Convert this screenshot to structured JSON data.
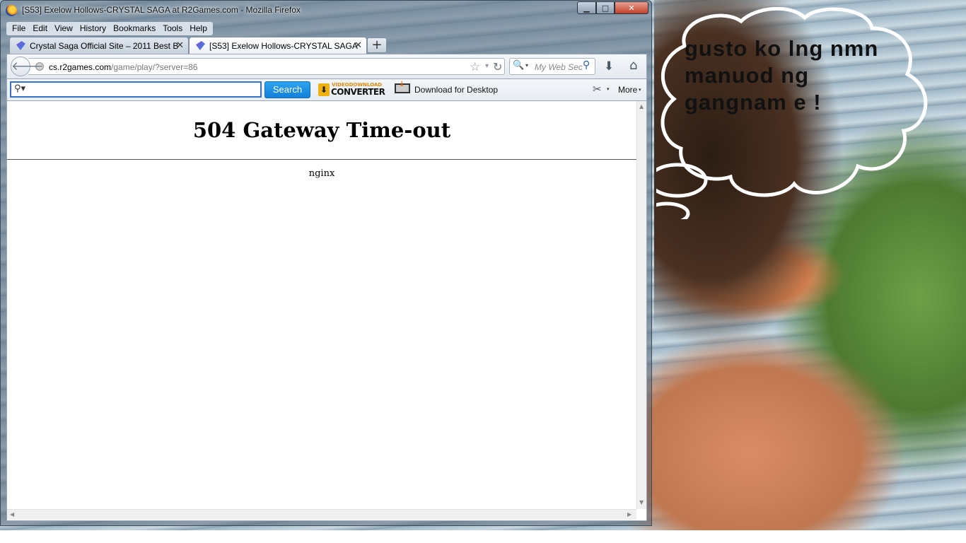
{
  "window": {
    "title": "[S53] Exelow Hollows-CRYSTAL SAGA at R2Games.com - Mozilla Firefox",
    "min_glyph": "▁",
    "max_glyph": "□",
    "close_glyph": "✕"
  },
  "menubar": {
    "items": [
      "File",
      "Edit",
      "View",
      "History",
      "Bookmarks",
      "Tools",
      "Help"
    ]
  },
  "tabs": [
    {
      "label": "Crystal Saga Official Site – 2011 Best B...",
      "active": false
    },
    {
      "label": "[S53] Exelow Hollows-CRYSTAL SAGA...",
      "active": true
    }
  ],
  "tab_close_glyph": "✕",
  "new_tab_glyph": "+",
  "navbar": {
    "back_glyph": "🡐",
    "url_domain": "cs.r2games.com",
    "url_path": "/game/play/?server=86",
    "star_glyph": "☆",
    "dropdown_glyph": "▾",
    "reload_glyph": "↻",
    "search_placeholder": "My Web Sec",
    "search_engine_glyph": "🔍",
    "search_go_glyph": "⚲",
    "downloads_glyph": "⬇",
    "home_glyph": "⌂"
  },
  "addon_toolbar": {
    "search_button": "Search",
    "search_icon_glyph": "⚲▾",
    "vdc_logo_top": "VIDEODOWNLOAD",
    "vdc_logo_bottom": "CONVERTER",
    "vdc_icon_glyph": "⬇",
    "desktop_arrow_glyph": "↓",
    "download_desktop": "Download for Desktop",
    "tools_glyph": "✂",
    "more": "More"
  },
  "page": {
    "heading": "504 Gateway Time-out",
    "server": "nginx"
  },
  "scroll": {
    "up": "▲",
    "down": "▼",
    "left": "◀",
    "right": "▶"
  },
  "wallpaper": {
    "thought_text_line1": "gusto ko lng nmn",
    "thought_text_line2": "manuod ng",
    "thought_text_line3": "gangnam e !"
  },
  "colors": {
    "accent_blue": "#1280d8",
    "close_red": "#c0402a"
  }
}
